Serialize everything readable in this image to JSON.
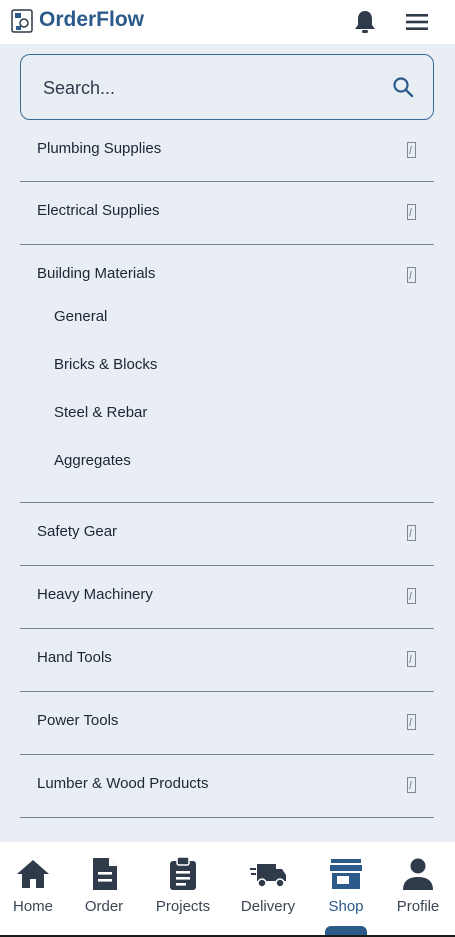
{
  "header": {
    "brand": "OrderFlow",
    "icons": [
      "logo-icon",
      "bell-icon",
      "menu-icon"
    ]
  },
  "search": {
    "placeholder": "Search...",
    "value": ""
  },
  "categories": [
    {
      "label": "Plumbing Supplies"
    },
    {
      "label": "Electrical Supplies"
    },
    {
      "label": "Building Materials",
      "expanded": true,
      "subitems": [
        "General",
        "Bricks & Blocks",
        "Steel & Rebar",
        "Aggregates"
      ]
    },
    {
      "label": "Safety Gear"
    },
    {
      "label": "Heavy Machinery"
    },
    {
      "label": "Hand Tools"
    },
    {
      "label": "Power Tools"
    },
    {
      "label": "Lumber & Wood Products"
    }
  ],
  "bottom_nav": [
    {
      "label": "Home",
      "icon": "home-icon"
    },
    {
      "label": "Order",
      "icon": "document-icon"
    },
    {
      "label": "Projects",
      "icon": "clipboard-icon"
    },
    {
      "label": "Delivery",
      "icon": "truck-icon"
    },
    {
      "label": "Shop",
      "icon": "store-icon",
      "active": true
    },
    {
      "label": "Profile",
      "icon": "person-icon"
    }
  ],
  "colors": {
    "accent": "#2c5a8a",
    "background": "#e9eef4",
    "header": "#ffffff"
  }
}
